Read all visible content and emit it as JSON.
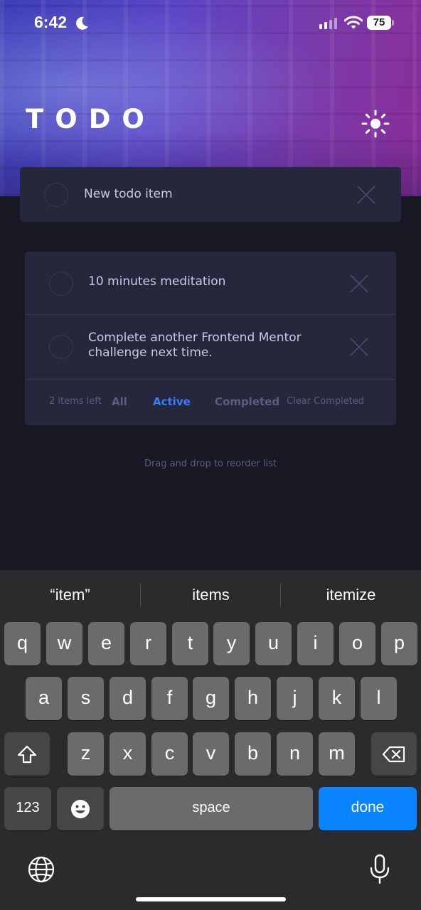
{
  "status_bar": {
    "time": "6:42",
    "battery": "75"
  },
  "app": {
    "title": "TODO",
    "theme_icon": "sun-icon"
  },
  "new_todo": {
    "value": "New todo item"
  },
  "todos": [
    {
      "text": "10 minutes meditation",
      "completed": false
    },
    {
      "text": "Complete another Frontend Mentor challenge next time.",
      "completed": false
    }
  ],
  "footer": {
    "items_left": "2 items left",
    "filters": {
      "all": "All",
      "active": "Active",
      "completed": "Completed"
    },
    "active_filter": "Active",
    "clear_completed": "Clear Completed"
  },
  "hint": "Drag and drop to reorder list",
  "colors": {
    "accent": "#3a7cfd",
    "background": "#171823",
    "card": "#25273d",
    "keyboard_done": "#0a84ff"
  },
  "keyboard": {
    "suggestions": [
      "“item”",
      "items",
      "itemize"
    ],
    "row1": [
      "q",
      "w",
      "e",
      "r",
      "t",
      "y",
      "u",
      "i",
      "o",
      "p"
    ],
    "row2": [
      "a",
      "s",
      "d",
      "f",
      "g",
      "h",
      "j",
      "k",
      "l"
    ],
    "row3": [
      "z",
      "x",
      "c",
      "v",
      "b",
      "n",
      "m"
    ],
    "numbers_key": "123",
    "space_key": "space",
    "done_key": "done"
  }
}
